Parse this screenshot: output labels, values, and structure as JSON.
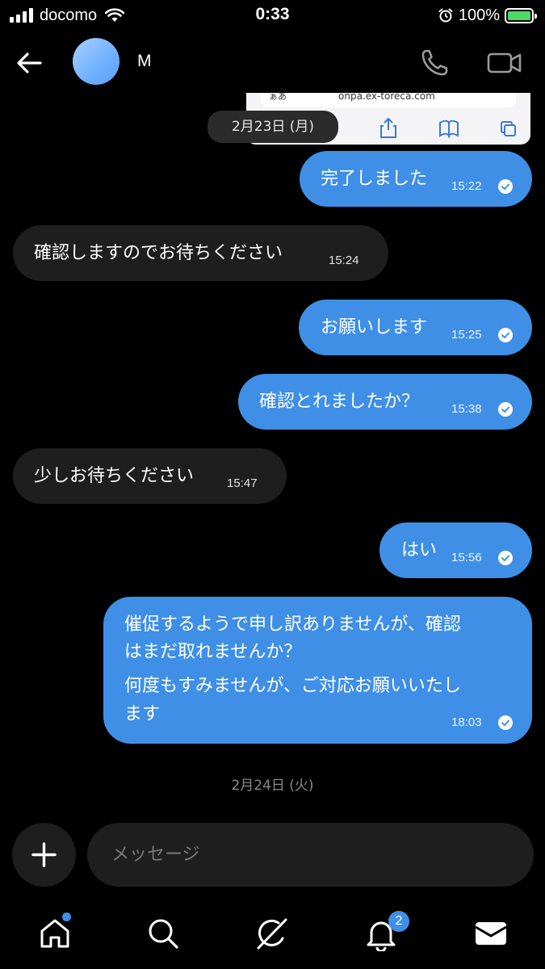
{
  "status_bar": {
    "carrier": "docomo",
    "time": "0:33",
    "battery": "100%"
  },
  "header": {
    "contact_name": "M"
  },
  "embedded_screenshot": {
    "aa_label": "ぁあ",
    "url_text": "onpa.ex-toreca.com"
  },
  "dates": {
    "first": "2月23日 (月)",
    "second": "2月24日 (火)"
  },
  "messages": [
    {
      "direction": "out",
      "text": "完了しました",
      "time": "15:22",
      "read": true
    },
    {
      "direction": "in",
      "text": "確認しますのでお待ちください",
      "time": "15:24"
    },
    {
      "direction": "out",
      "text": "お願いします",
      "time": "15:25",
      "read": true
    },
    {
      "direction": "out",
      "text": "確認とれましたか？",
      "time": "15:38",
      "read": true
    },
    {
      "direction": "in",
      "text": "少しお待ちください",
      "time": "15:47"
    },
    {
      "direction": "out",
      "text": "はい",
      "time": "15:56",
      "read": true
    },
    {
      "direction": "out",
      "lines": [
        "催促するようで申し訳ありませんが、確認",
        "はまだ取れませんか？",
        "何度もすみませんが、ご対応お願いいたし",
        "ます"
      ],
      "time": "18:03",
      "read": true
    }
  ],
  "composer": {
    "placeholder": "メッセージ"
  },
  "tabbar": {
    "notifications_count": "2"
  },
  "icons": {
    "back": "arrow-left-icon",
    "call": "phone-icon",
    "video": "video-camera-icon",
    "add": "plus-icon",
    "home": "home-icon",
    "search": "search-icon",
    "grok": "slash-circle-icon",
    "notifications": "bell-icon",
    "messages": "envelope-icon"
  },
  "colors": {
    "outgoing_bubble": "#3f8fe6",
    "incoming_bubble": "#1e1e1e",
    "background": "#000000",
    "accent": "#3f8fe6"
  }
}
